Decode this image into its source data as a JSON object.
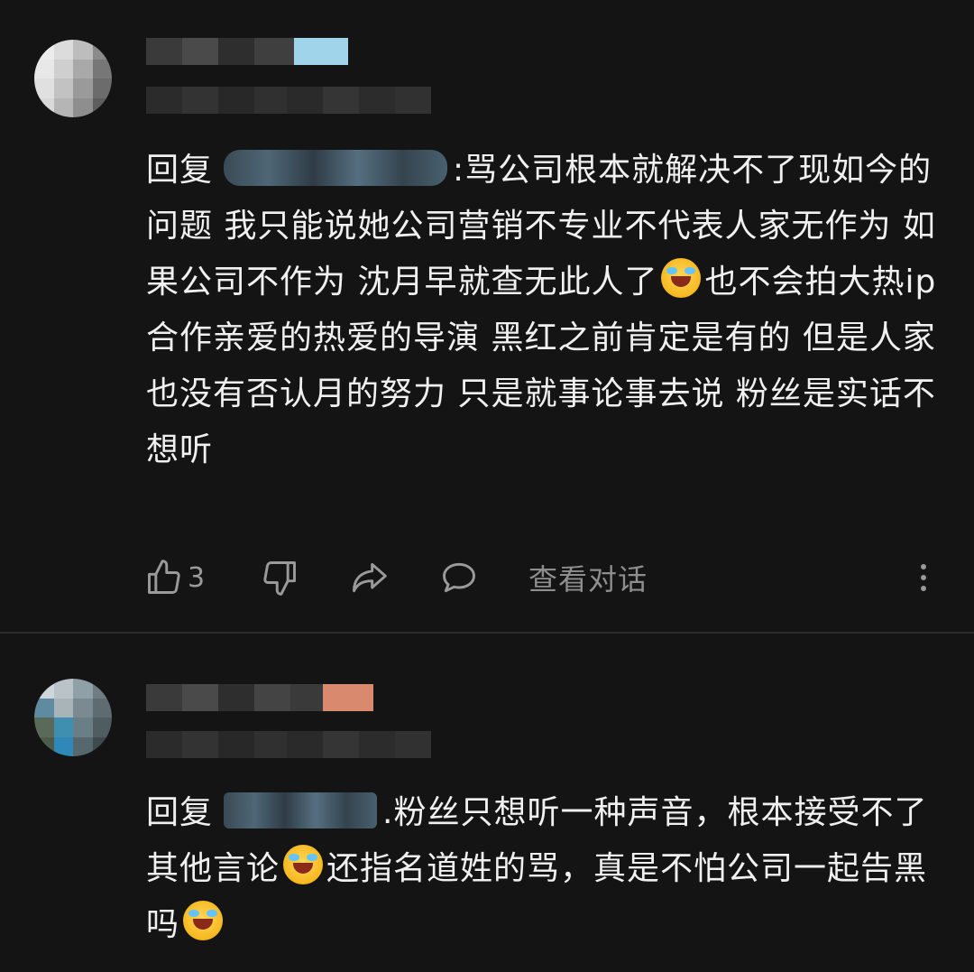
{
  "comment1": {
    "reply_prefix": "回复",
    "text": ":骂公司根本就解决不了现如今的问题 我只能说她公司营销不专业不代表人家无作为 如果公司不作为 沈月早就查无此人了",
    "text_after_emoji": "也不会拍大热ip 合作亲爱的热爱的导演 黑红之前肯定是有的 但是人家也没有否认月的努力 只是就事论事去说 粉丝是实话不想听",
    "like_count": "3",
    "view_conversation": "查看对话"
  },
  "comment2": {
    "reply_prefix": "回复",
    "text": ".粉丝只想听一种声音，根本接受不了其他言论",
    "text_after_emoji": "还指名道姓的骂，真是不怕公司一起告黑吗"
  },
  "icons": {
    "like": "thumb-up-icon",
    "dislike": "thumb-down-icon",
    "share": "share-icon",
    "reply": "comment-icon",
    "more": "more-vertical-icon",
    "emoji": "laughing-crying-emoji"
  },
  "colors": {
    "background": "#141414",
    "text": "#f0f0f0",
    "secondary_text": "#8e8e8e",
    "divider": "#2a2a2a"
  }
}
